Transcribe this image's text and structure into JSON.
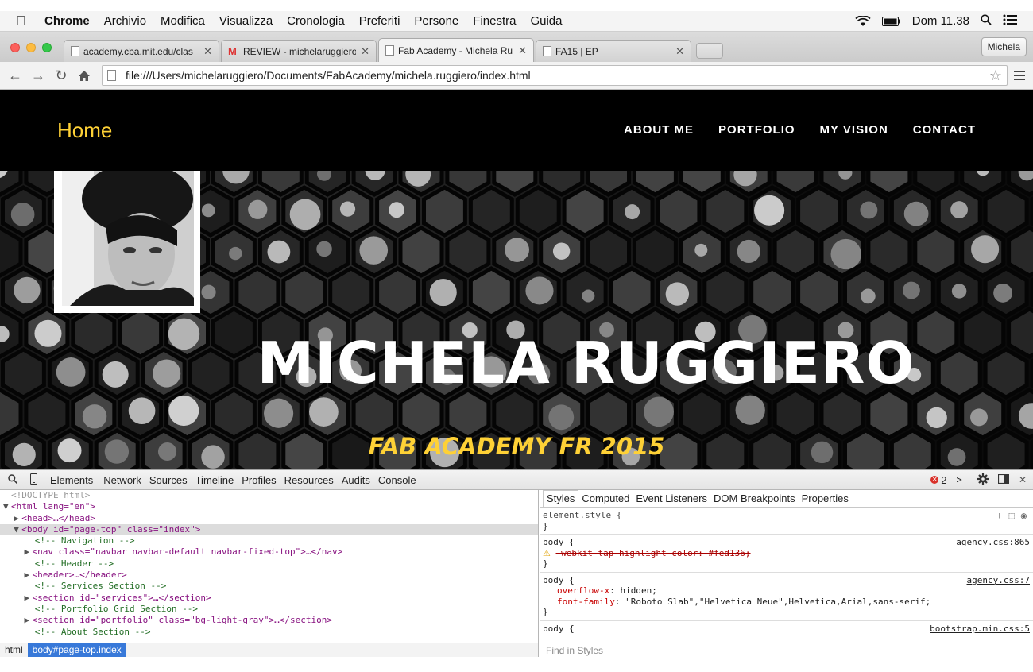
{
  "menubar": {
    "app": "Chrome",
    "items": [
      "Archivio",
      "Modifica",
      "Visualizza",
      "Cronologia",
      "Preferiti",
      "Persone",
      "Finestra",
      "Guida"
    ],
    "clock": "Dom 11.38"
  },
  "tabs": [
    {
      "label": "academy.cba.mit.edu/clas",
      "icon": "page-icon"
    },
    {
      "label": "REVIEW - michelaruggiero",
      "icon": "gmail-icon"
    },
    {
      "label": "Fab Academy - Michela Ru",
      "icon": "page-icon",
      "active": true
    },
    {
      "label": "FA15 | EP",
      "icon": "page-icon"
    }
  ],
  "profile": "Michela",
  "address": "file:///Users/michelaruggiero/Documents/FabAcademy/michela.ruggiero/index.html",
  "site": {
    "brand": "Home",
    "nav": [
      "ABOUT ME",
      "PORTFOLIO",
      "MY VISION",
      "CONTACT"
    ],
    "hero_name": "MICHELA RUGGIERO",
    "hero_sub": "FAB ACADEMY FR 2015",
    "brand_color": "#fed136"
  },
  "devtools": {
    "tabs": [
      "Elements",
      "Network",
      "Sources",
      "Timeline",
      "Profiles",
      "Resources",
      "Audits",
      "Console"
    ],
    "active_tab": "Elements",
    "error_count": "2",
    "side_tabs": [
      "Styles",
      "Computed",
      "Event Listeners",
      "DOM Breakpoints",
      "Properties"
    ],
    "breadcrumb": [
      "html",
      "body#page-top.index"
    ],
    "find_placeholder": "Find in Styles",
    "dom": {
      "doctype": "<!DOCTYPE html>",
      "html_open": "<html lang=\"en\">",
      "head": "<head>…</head>",
      "body_open": "<body id=\"page-top\" class=\"index\">",
      "c_nav": "<!-- Navigation -->",
      "nav": "<nav class=\"navbar navbar-default navbar-fixed-top\">…</nav>",
      "c_header": "<!-- Header -->",
      "header": "<header>…</header>",
      "c_services": "<!-- Services Section -->",
      "services": "<section id=\"services\">…</section>",
      "c_portfolio": "<!-- Portfolio Grid Section -->",
      "portfolio": "<section id=\"portfolio\" class=\"bg-light-gray\">…</section>",
      "c_about": "<!-- About Section -->"
    },
    "styles": {
      "element_style": "element.style {",
      "close": "}",
      "rule1_sel": "body {",
      "rule1_src": "agency.css:865",
      "rule1_prop": "-webkit-tap-highlight-color: #fed136;",
      "rule2_sel": "body {",
      "rule2_src": "agency.css:7",
      "rule2_p1_name": "overflow-x",
      "rule2_p1_val": ": hidden;",
      "rule2_p2_name": "font-family",
      "rule2_p2_val": ": \"Roboto Slab\",\"Helvetica Neue\",Helvetica,Arial,sans-serif;",
      "rule3_sel": "body {",
      "rule3_src": "bootstrap.min.css:5"
    }
  }
}
